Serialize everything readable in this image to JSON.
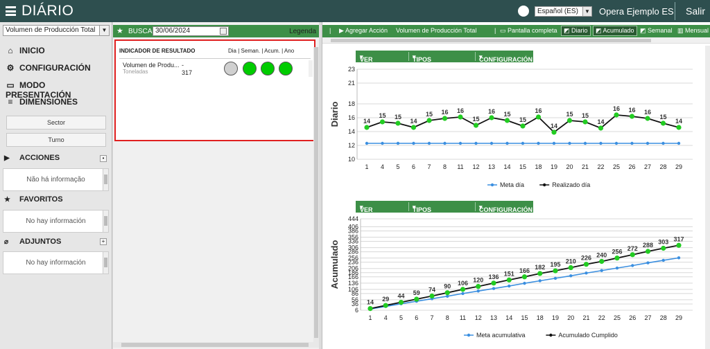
{
  "app": {
    "title": "DIÁRIO",
    "language": "Español (ES)",
    "company": "Opera Ejemplo ES",
    "logout": "Salir"
  },
  "sidebar": {
    "indicator_select": "Volumen de Producción Total",
    "menu": [
      {
        "label": "INICIO",
        "icon": "home-icon"
      },
      {
        "label": "CONFIGURACIÓN",
        "icon": "gear-icon"
      },
      {
        "label": "MODO PRESENTACIÓN",
        "icon": "monitor-icon"
      },
      {
        "label": "DIMENSIONES",
        "icon": "database-icon"
      }
    ],
    "dimensions": [
      "Sector",
      "Turno"
    ],
    "sections": [
      {
        "label": "ACCIONES",
        "icon": "play-icon",
        "empty": "Não há informação"
      },
      {
        "label": "FAVORITOS",
        "icon": "star-icon",
        "empty": "No hay información"
      },
      {
        "label": "ADJUNTOS",
        "icon": "paperclip-icon",
        "empty": "No hay información"
      }
    ]
  },
  "search": {
    "label": "BUSCA",
    "date": "30/06/2024",
    "legend": "Legenda"
  },
  "table": {
    "col1": "INDICADOR DE RESULTADO",
    "col2": "Dia | Seman. | Acum. | Ano",
    "row": {
      "name": "Volumen de Produ...",
      "unit": "Toneladas",
      "dash": "-",
      "value": "317",
      "statuses": [
        "#d0d0d0",
        "#00cc00",
        "#00cc00",
        "#00cc00"
      ]
    }
  },
  "toolbar": {
    "add_action": "Agregar Acción",
    "indicator": "Volumen de Producción Total",
    "fullscreen": "Pantalla completa",
    "daily": "Diario",
    "cumulative": "Acumulado",
    "weekly": "Semanal",
    "monthly": "Mensual"
  },
  "chart_menu": {
    "values": "VER VALORES",
    "types": "TIPOS DE GRÁFICO",
    "config": "CONFIGURACIÓN"
  },
  "chart_data": [
    {
      "type": "line",
      "ylabel": "Diario",
      "ylim": [
        10,
        23
      ],
      "yticks": [
        10,
        12,
        14,
        16,
        18,
        21,
        23
      ],
      "categories": [
        "1",
        "4",
        "5",
        "6",
        "7",
        "8",
        "11",
        "12",
        "13",
        "14",
        "15",
        "18",
        "19",
        "20",
        "21",
        "22",
        "25",
        "26",
        "27",
        "28",
        "29"
      ],
      "series": [
        {
          "name": "Meta día",
          "color": "#3b8fe0",
          "values": [
            12.3,
            12.3,
            12.3,
            12.3,
            12.3,
            12.3,
            12.3,
            12.3,
            12.3,
            12.3,
            12.3,
            12.3,
            12.3,
            12.3,
            12.3,
            12.3,
            12.3,
            12.3,
            12.3,
            12.3,
            12.3
          ]
        },
        {
          "name": "Realizado día",
          "color": "#111111",
          "values": [
            14.6,
            15.4,
            15.2,
            14.6,
            15.6,
            15.9,
            16.1,
            14.9,
            16.0,
            15.6,
            14.8,
            16.1,
            13.9,
            15.6,
            15.4,
            14.5,
            16.4,
            16.2,
            15.9,
            15.2,
            14.6
          ],
          "labels": [
            "14",
            "15",
            "15",
            "14",
            "15",
            "16",
            "16",
            "15",
            "16",
            "15",
            "15",
            "16",
            "14",
            "15",
            "15",
            "14",
            "16",
            "16",
            "16",
            "15",
            "14"
          ]
        }
      ],
      "grid": true,
      "legend": "bottom"
    },
    {
      "type": "line",
      "ylabel": "Acumulado",
      "ylim": [
        6,
        444
      ],
      "yticks": [
        6,
        36,
        56,
        86,
        106,
        136,
        166,
        186,
        206,
        236,
        256,
        286,
        306,
        336,
        356,
        386,
        406,
        444
      ],
      "categories": [
        "1",
        "4",
        "5",
        "6",
        "7",
        "8",
        "11",
        "12",
        "13",
        "14",
        "15",
        "18",
        "19",
        "20",
        "21",
        "22",
        "25",
        "26",
        "27",
        "28",
        "29"
      ],
      "series": [
        {
          "name": "Meta acumulativa",
          "color": "#3b8fe0",
          "values": [
            12,
            24,
            37,
            49,
            61,
            73,
            86,
            98,
            110,
            122,
            135,
            147,
            159,
            171,
            184,
            196,
            208,
            220,
            233,
            245,
            257
          ]
        },
        {
          "name": "Acumulado Cumplido",
          "color": "#111111",
          "values": [
            14,
            29,
            44,
            59,
            74,
            90,
            106,
            120,
            136,
            151,
            166,
            182,
            195,
            210,
            226,
            240,
            256,
            272,
            288,
            303,
            317
          ],
          "labels": [
            "14",
            "29",
            "44",
            "59",
            "74",
            "90",
            "106",
            "120",
            "136",
            "151",
            "166",
            "182",
            "195",
            "210",
            "226",
            "240",
            "256",
            "272",
            "288",
            "303",
            "317"
          ]
        }
      ],
      "grid": true,
      "legend": "bottom"
    }
  ]
}
